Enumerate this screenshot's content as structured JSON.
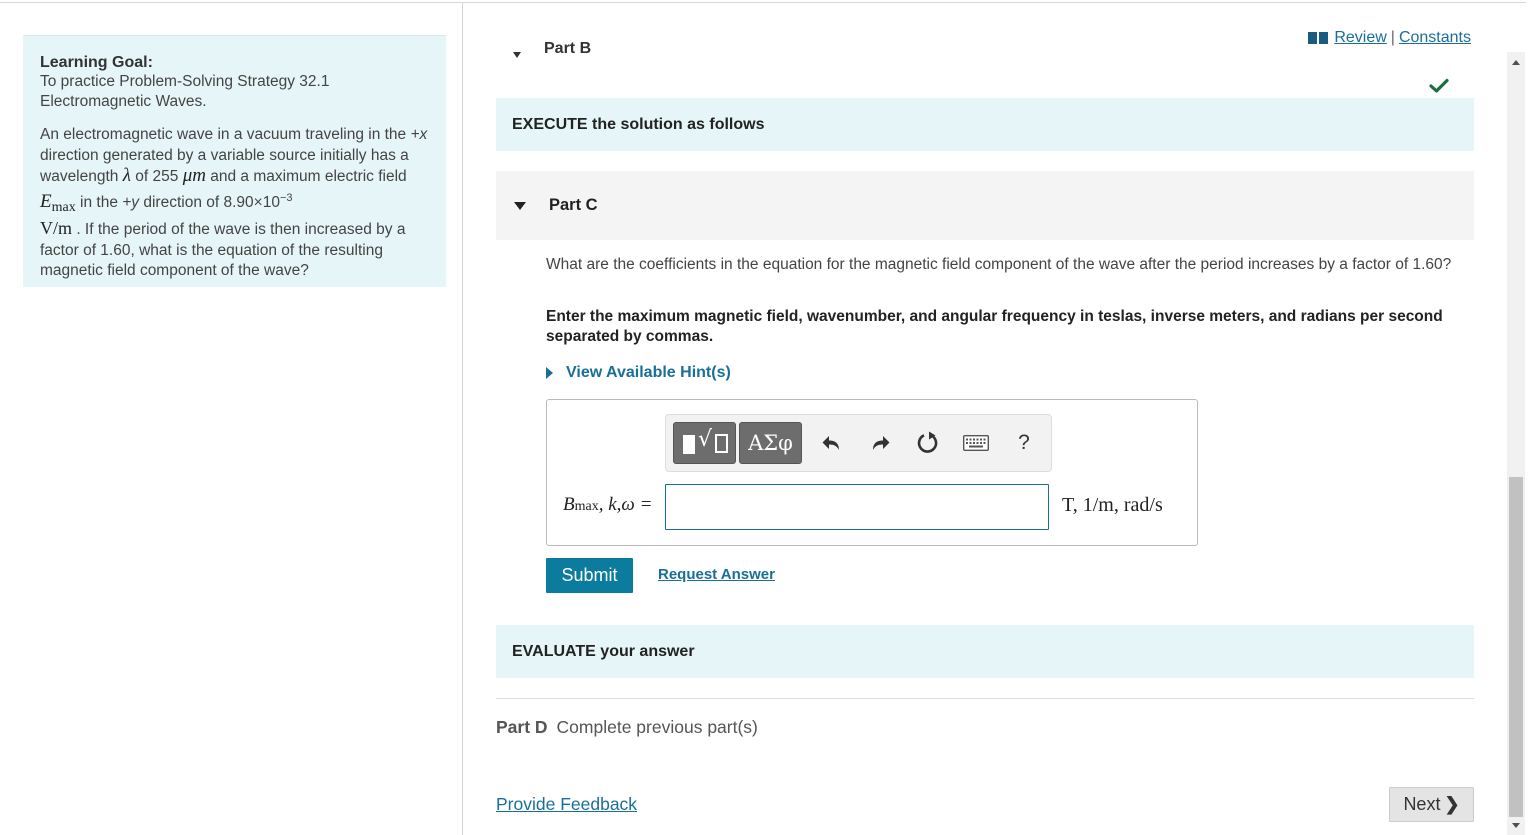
{
  "learning_goal": {
    "title": "Learning Goal:",
    "subtitle": "To practice Problem-Solving Strategy 32.1 Electromagnetic Waves.",
    "problem": {
      "t1": "An electromagnetic wave in a vacuum traveling in the ",
      "t2": "+x",
      "t3": " direction generated by a variable source initially has a wavelength ",
      "lambda": "λ",
      "t4": " of 255 ",
      "unit_um": "μm",
      "t5": " and a maximum electric field ",
      "emax_E": "E",
      "emax_sub": "max",
      "t6": " in the ",
      "t7": "+y",
      "t8": " direction of 8.90×10",
      "exp": "−3",
      "unit_vm": "V/m",
      "t9": " . If the period of the wave is then increased by a factor of 1.60, what is the equation of the resulting magnetic field component of the wave?"
    }
  },
  "header_links": {
    "review": "Review",
    "separator": "|",
    "constants": "Constants"
  },
  "part_b": {
    "label": "Part B"
  },
  "execute_band": "EXECUTE the solution as follows",
  "part_c": {
    "label": "Part C",
    "question": "What are the coefficients in the equation for the magnetic field component of the wave after the period increases by a factor of 1.60?",
    "instruction": "Enter the maximum magnetic field, wavenumber, and angular frequency in teslas, inverse meters, and radians per second separated by commas.",
    "hints": "View Available Hint(s)",
    "toolbar": {
      "greek_label": "ΑΣφ",
      "help_label": "?"
    },
    "answer": {
      "var_B": "B",
      "var_B_sub": "max",
      "var_rest": ", k,ω =",
      "value": "",
      "units": "T, 1/m, rad/s"
    },
    "submit": "Submit",
    "request_answer": "Request Answer"
  },
  "evaluate_band": "EVALUATE your answer",
  "part_d": {
    "label": "Part D",
    "status": "Complete previous part(s)"
  },
  "footer": {
    "feedback": "Provide Feedback",
    "next": "Next"
  },
  "colors": {
    "accent": "#1a6f99",
    "submit_bg": "#0b7b9e",
    "band_bg": "#e6f5f7",
    "check": "#1a6f3c"
  },
  "icons": [
    "book-icon",
    "check-icon",
    "template-icon",
    "undo-icon",
    "redo-icon",
    "reset-icon",
    "keyboard-icon",
    "help-icon",
    "chevron-right-icon"
  ]
}
